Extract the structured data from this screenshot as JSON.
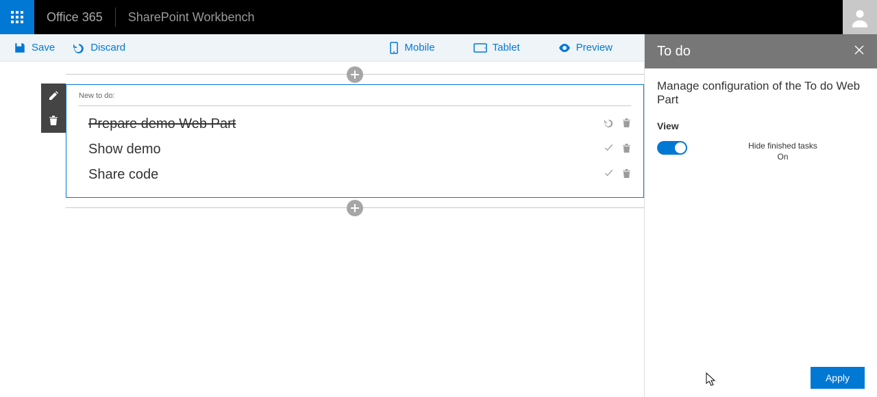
{
  "topbar": {
    "brand": "Office 365",
    "subbrand": "SharePoint Workbench"
  },
  "cmdbar": {
    "save": "Save",
    "discard": "Discard",
    "mobile": "Mobile",
    "tablet": "Tablet",
    "preview": "Preview"
  },
  "webpart": {
    "input_label": "New to do:",
    "items": [
      {
        "label": "Prepare demo Web Part",
        "done": true
      },
      {
        "label": "Show demo",
        "done": false
      },
      {
        "label": "Share code",
        "done": false
      }
    ]
  },
  "pane": {
    "title": "To do",
    "description": "Manage configuration of the To do Web Part",
    "section": "View",
    "toggle_label": "Hide finished tasks",
    "toggle_state": "On",
    "apply": "Apply"
  }
}
